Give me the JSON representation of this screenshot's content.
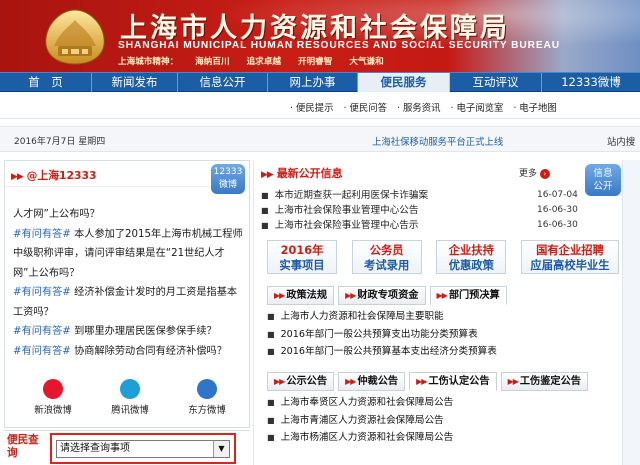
{
  "header": {
    "title_cn": "上海市人力资源和社会保障局",
    "title_en": "SHANGHAI MUNICIPAL HUMAN RESOURCES AND SOCIAL SECURITY BUREAU",
    "spirit": [
      "上海城市精神：",
      "海纳百川",
      "追求卓越",
      "开明睿智",
      "大气谦和"
    ]
  },
  "nav": {
    "items": [
      "首　页",
      "新闻发布",
      "信息公开",
      "网上办事",
      "便民服务",
      "互动评议",
      "12333微博"
    ],
    "active_index": 4
  },
  "subnav": {
    "items": [
      "便民提示",
      "便民问答",
      "服务资讯",
      "电子阅览室",
      "电子地图"
    ]
  },
  "infobar": {
    "date": "2016年7月7日 星期四",
    "marquee": "上海社保移动服务平台正式上线",
    "search_label": "站内搜"
  },
  "weibo": {
    "title": "@上海12333",
    "badge": [
      "12333",
      "微博"
    ],
    "posts": [
      {
        "tag": "",
        "text": "人才网”上公布吗？"
      },
      {
        "tag": "#有问有答#",
        "text": "本人参加了2015年上海市机械工程师中级职称评审，请问评审结果是在“21世纪人才网”上公布吗？"
      },
      {
        "tag": "#有问有答#",
        "text": "经济补偿金计发时的月工资是指基本工资吗？"
      },
      {
        "tag": "#有问有答#",
        "text": "到哪里办理居民医保参保手续？"
      },
      {
        "tag": "#有问有答#",
        "text": "协商解除劳动合同有经济补偿吗？"
      }
    ],
    "share": [
      {
        "label": "新浪微博",
        "icon": "sina-weibo-icon",
        "color": "#e6162d"
      },
      {
        "label": "腾讯微博",
        "icon": "tencent-weibo-icon",
        "color": "#1f9ed8"
      },
      {
        "label": "东方微博",
        "icon": "dongfang-weibo-icon",
        "color": "#2f75c9"
      }
    ]
  },
  "query": {
    "label": "便民查询",
    "select_value": "请选择查询事项"
  },
  "news": {
    "title": "最新公开信息",
    "more": "更多",
    "badge": [
      "信息",
      "公开"
    ],
    "items": [
      {
        "text": "本市近期查获一起利用医保卡诈骗案",
        "date": "16-07-04"
      },
      {
        "text": "上海市社会保险事业管理中心公告",
        "date": "16-06-30"
      },
      {
        "text": "上海市社会保险事业管理中心告示",
        "date": "16-06-30"
      }
    ]
  },
  "features": [
    {
      "line1": "2016年",
      "line2": "实事项目"
    },
    {
      "line1": "公务员",
      "line2": "考试录用"
    },
    {
      "line1": "企业扶持",
      "line2": "优惠政策"
    },
    {
      "line1": "国有企业招聘",
      "line2": "应届高校毕业生"
    }
  ],
  "tabs1": {
    "items": [
      "政策法规",
      "财政专项资金",
      "部门预决算"
    ],
    "active_index": 2,
    "list": [
      "上海市人力资源和社会保障局主要职能",
      "2016年部门一般公共预算支出功能分类预算表",
      "2016年部门一般公共预算基本支出经济分类预算表"
    ]
  },
  "tabs2": {
    "items": [
      "公示公告",
      "仲裁公告",
      "工伤认定公告",
      "工伤鉴定公告"
    ],
    "active_index": 2,
    "list": [
      "上海市奉贤区人力资源和社会保障局公告",
      "上海市青浦区人力资源社会保障局公告",
      "上海市杨浦区人力资源和社会保障局公告"
    ]
  },
  "colors": {
    "brand_red": "#cc1d14",
    "nav_blue": "#1c5ea6",
    "link_blue": "#1f5ea8"
  }
}
